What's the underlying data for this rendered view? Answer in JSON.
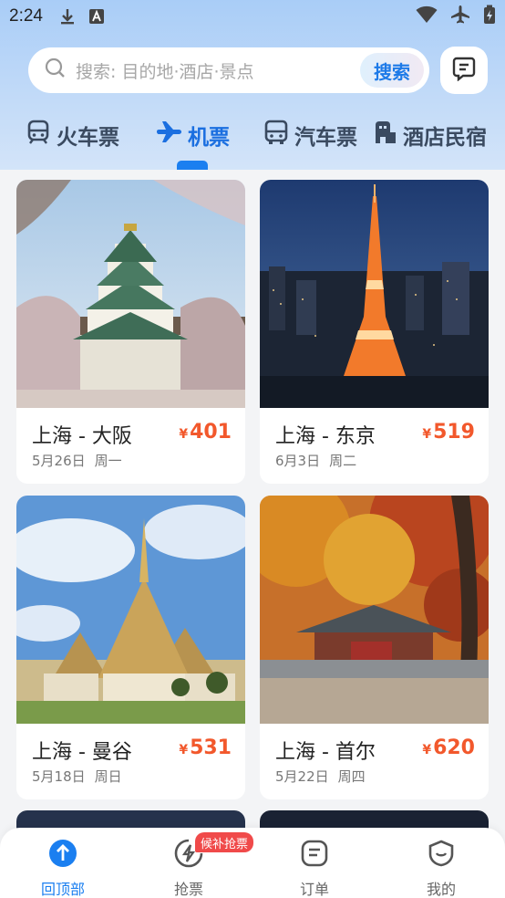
{
  "status_bar": {
    "time": "2:24",
    "left_icons": [
      "download-icon",
      "text-a-icon"
    ],
    "right_icons": [
      "wifi-icon",
      "airplane-mode-icon",
      "battery-icon"
    ]
  },
  "search": {
    "placeholder": "搜索: 目的地·酒店·景点",
    "button_label": "搜索",
    "message_icon": "message-icon"
  },
  "tabs": [
    {
      "label": "火车票",
      "icon": "train-icon",
      "active": false
    },
    {
      "label": "机票",
      "icon": "plane-icon",
      "active": true
    },
    {
      "label": "汽车票",
      "icon": "bus-icon",
      "active": false
    },
    {
      "label": "酒店民宿",
      "icon": "hotel-icon",
      "active": false
    }
  ],
  "cards": [
    {
      "route": "上海 - 大阪",
      "currency": "¥",
      "price": "401",
      "date": "5月26日",
      "weekday": "周一",
      "image": "osaka-castle"
    },
    {
      "route": "上海 - 东京",
      "currency": "¥",
      "price": "519",
      "date": "6月3日",
      "weekday": "周二",
      "image": "tokyo-tower"
    },
    {
      "route": "上海 - 曼谷",
      "currency": "¥",
      "price": "531",
      "date": "5月18日",
      "weekday": "周日",
      "image": "bangkok-palace"
    },
    {
      "route": "上海 - 首尔",
      "currency": "¥",
      "price": "620",
      "date": "5月22日",
      "weekday": "周四",
      "image": "seoul-palace"
    }
  ],
  "bottom_nav": [
    {
      "label": "回顶部",
      "icon": "arrow-up-icon",
      "active": true
    },
    {
      "label": "抢票",
      "icon": "lightning-icon",
      "active": false
    },
    {
      "label": "订单",
      "icon": "order-icon",
      "active": false
    },
    {
      "label": "我的",
      "icon": "profile-icon",
      "active": false
    }
  ],
  "nav_badge": "候补抢票",
  "colors": {
    "accent": "#1b7ff0",
    "price": "#f2582c",
    "badge": "#f04a4a"
  }
}
